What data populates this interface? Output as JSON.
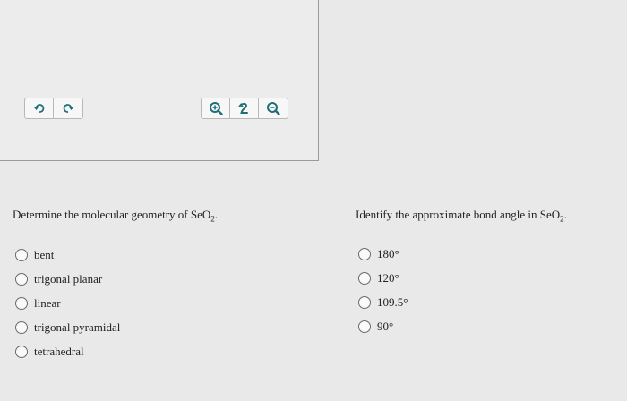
{
  "toolbar_left": {
    "buttons": [
      {
        "name": "undo-button",
        "icon": "undo-icon"
      },
      {
        "name": "redo-button",
        "icon": "redo-icon"
      }
    ]
  },
  "toolbar_right": {
    "buttons": [
      {
        "name": "zoom-in-button",
        "icon": "zoom-in-icon"
      },
      {
        "name": "reset-view-button",
        "icon": "reset-icon"
      },
      {
        "name": "zoom-out-button",
        "icon": "zoom-out-icon"
      }
    ]
  },
  "colors": {
    "icon_teal": "#1f6f78",
    "background": "#e9e9e9",
    "border": "#9a9a9a"
  },
  "question1": {
    "prefix": "Determine the molecular geometry of SeO",
    "subscript": "2",
    "suffix": ".",
    "options": [
      "bent",
      "trigonal planar",
      "linear",
      "trigonal pyramidal",
      "tetrahedral"
    ]
  },
  "question2": {
    "prefix": "Identify the approximate bond angle in SeO",
    "subscript": "2",
    "suffix": ".",
    "options": [
      "180°",
      "120°",
      "109.5°",
      "90°"
    ]
  }
}
